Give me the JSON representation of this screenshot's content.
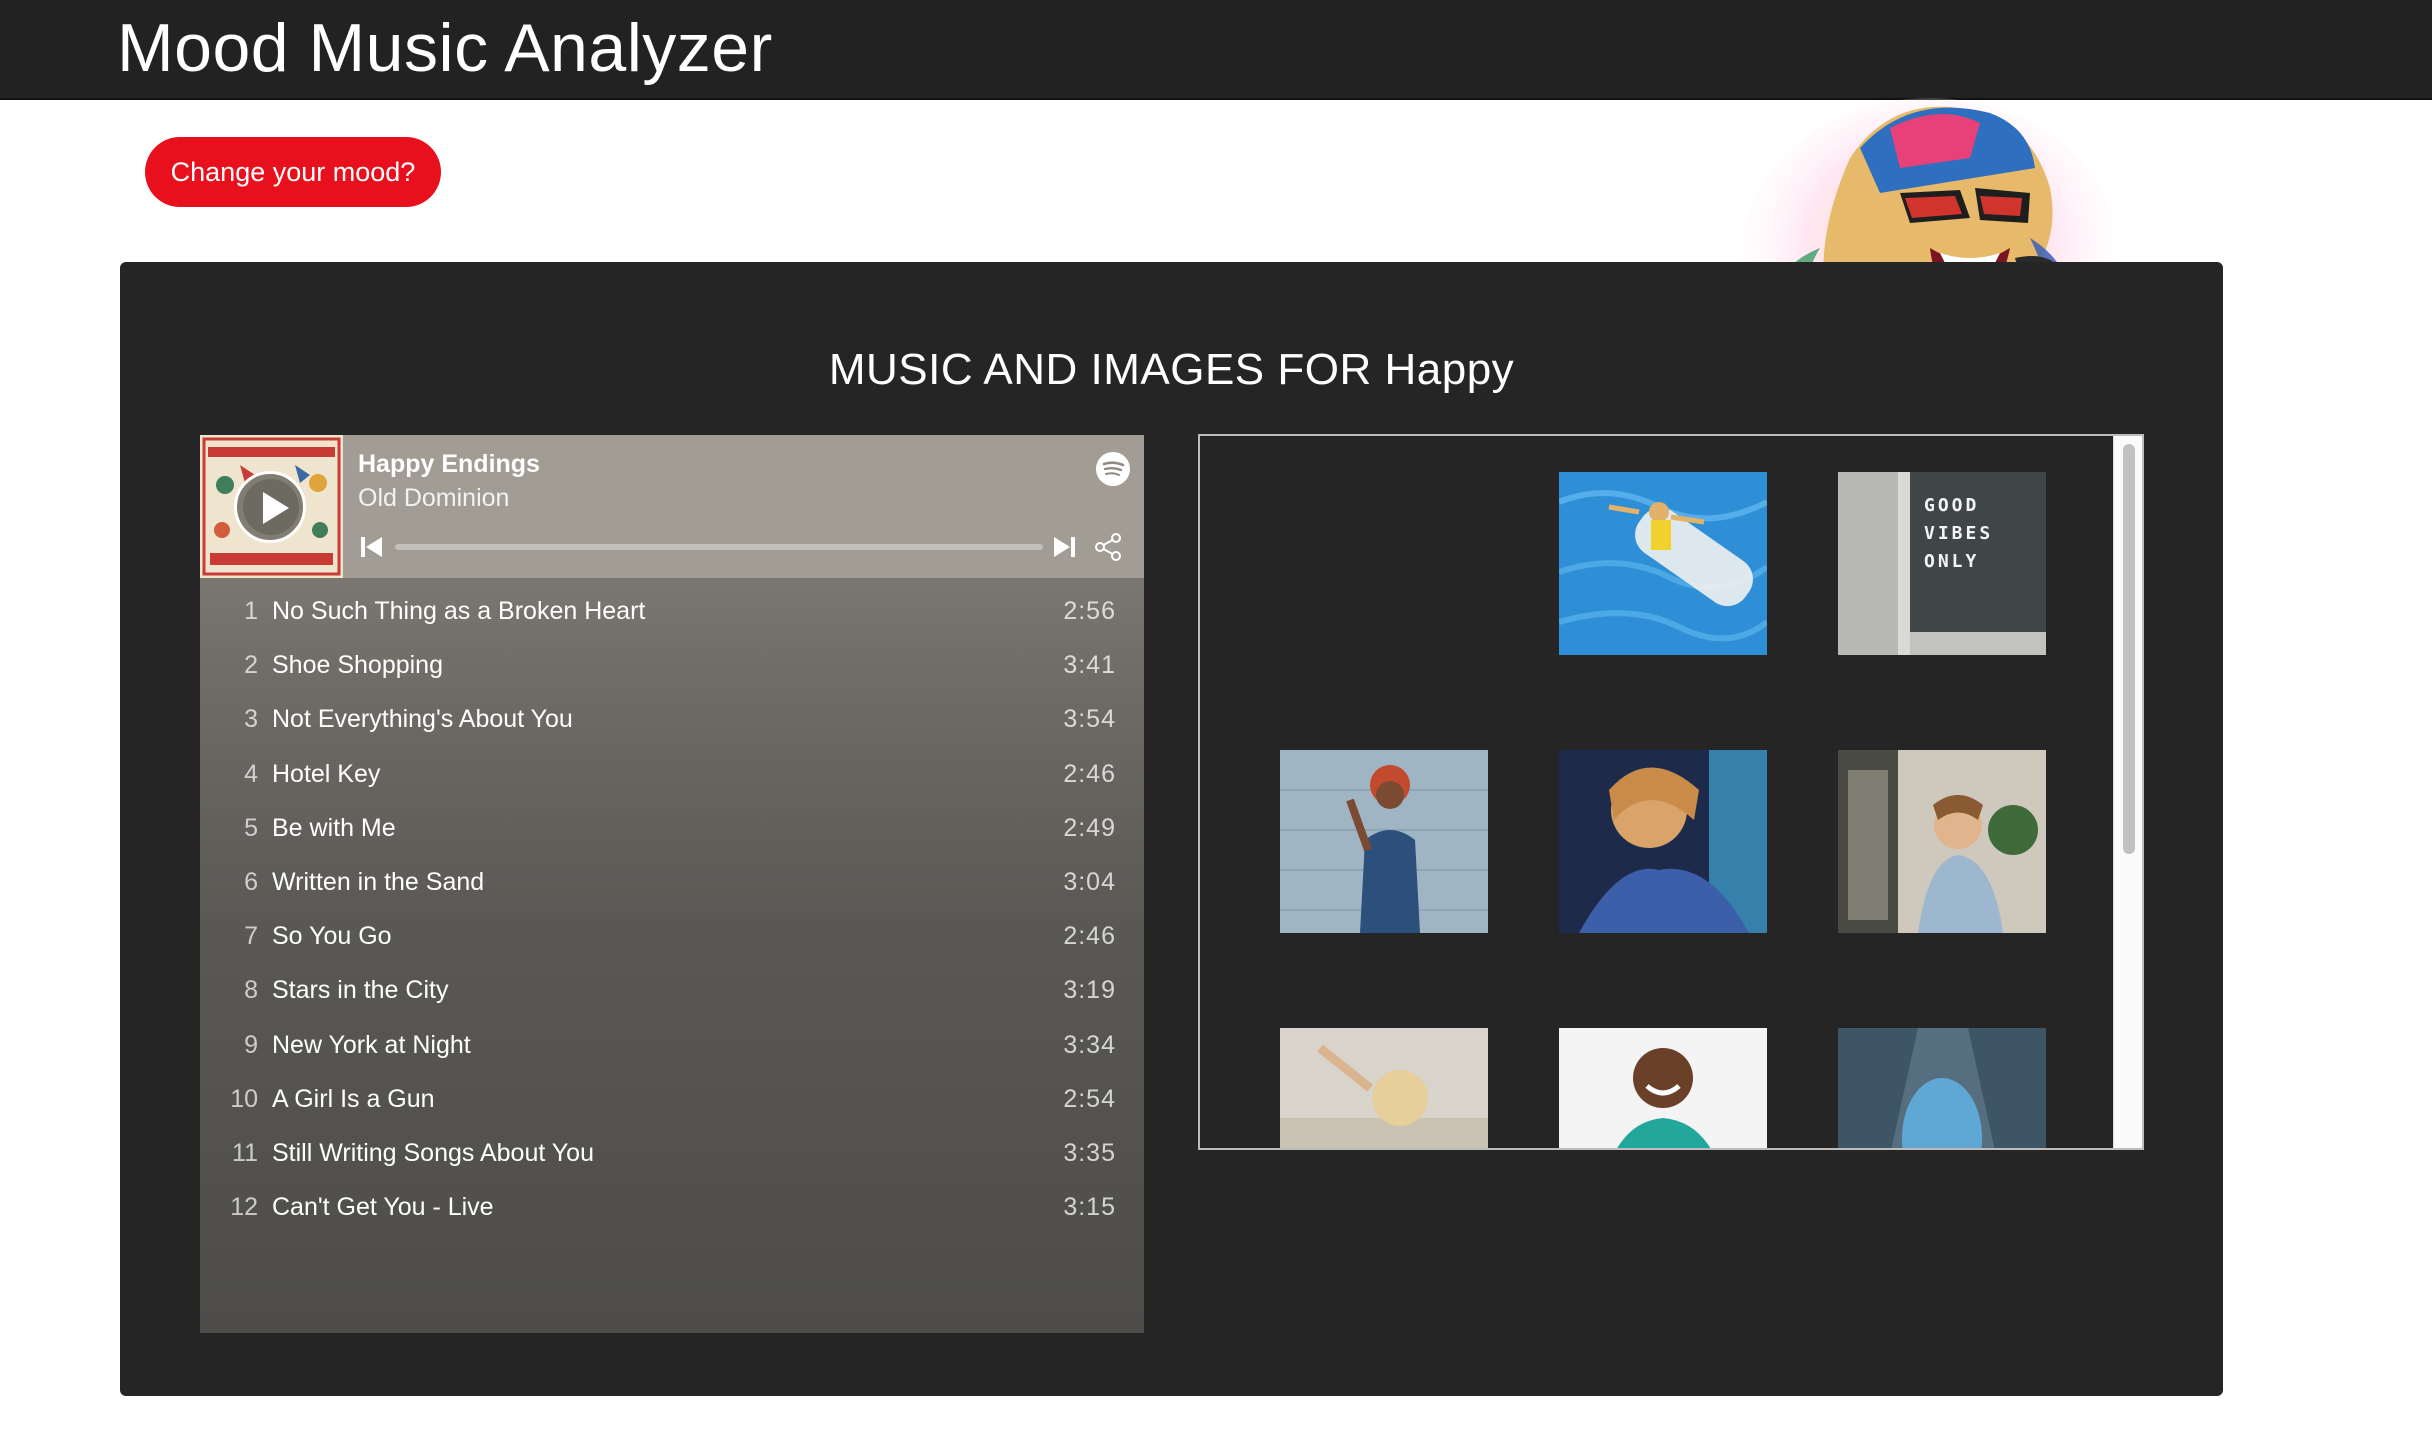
{
  "header": {
    "title": "Mood Music Analyzer"
  },
  "actions": {
    "change_mood_label": "Change your mood?"
  },
  "section": {
    "title": "MUSIC AND IMAGES FOR Happy"
  },
  "player": {
    "title": "Happy Endings",
    "artist": "Old Dominion",
    "icons": [
      "play-icon",
      "spotify-icon",
      "previous-icon",
      "next-icon",
      "share-icon"
    ],
    "tracks": [
      {
        "num": "1",
        "name": "No Such Thing as a Broken Heart",
        "duration": "2:56"
      },
      {
        "num": "2",
        "name": "Shoe Shopping",
        "duration": "3:41"
      },
      {
        "num": "3",
        "name": "Not Everything's About You",
        "duration": "3:54"
      },
      {
        "num": "4",
        "name": "Hotel Key",
        "duration": "2:46"
      },
      {
        "num": "5",
        "name": "Be with Me",
        "duration": "2:49"
      },
      {
        "num": "6",
        "name": "Written in the Sand",
        "duration": "3:04"
      },
      {
        "num": "7",
        "name": "So You Go",
        "duration": "2:46"
      },
      {
        "num": "8",
        "name": "Stars in the City",
        "duration": "3:19"
      },
      {
        "num": "9",
        "name": "New York at Night",
        "duration": "3:34"
      },
      {
        "num": "10",
        "name": "A Girl Is a Gun",
        "duration": "2:54"
      },
      {
        "num": "11",
        "name": "Still Writing Songs About You",
        "duration": "3:35"
      },
      {
        "num": "12",
        "name": "Can't Get You - Live",
        "duration": "3:15"
      }
    ]
  },
  "gallery": {
    "sign_text": "GOOD\nVIBES\nONLY"
  },
  "colors": {
    "header_bg": "#222222",
    "accent": "#e8101c",
    "panel_bg": "#252525"
  }
}
